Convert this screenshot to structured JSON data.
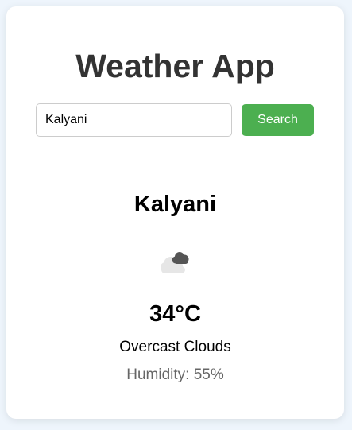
{
  "app": {
    "title": "Weather App"
  },
  "search": {
    "value": "Kalyani",
    "button_label": "Search"
  },
  "weather": {
    "city": "Kalyani",
    "icon": "overcast-clouds-icon",
    "temperature": "34°C",
    "description": "Overcast Clouds",
    "humidity": "Humidity: 55%"
  },
  "colors": {
    "page_background": "#eef5fc",
    "card_background": "#ffffff",
    "title_text": "#333333",
    "button_background": "#4caf50",
    "button_text": "#ffffff",
    "humidity_text": "#666666"
  }
}
